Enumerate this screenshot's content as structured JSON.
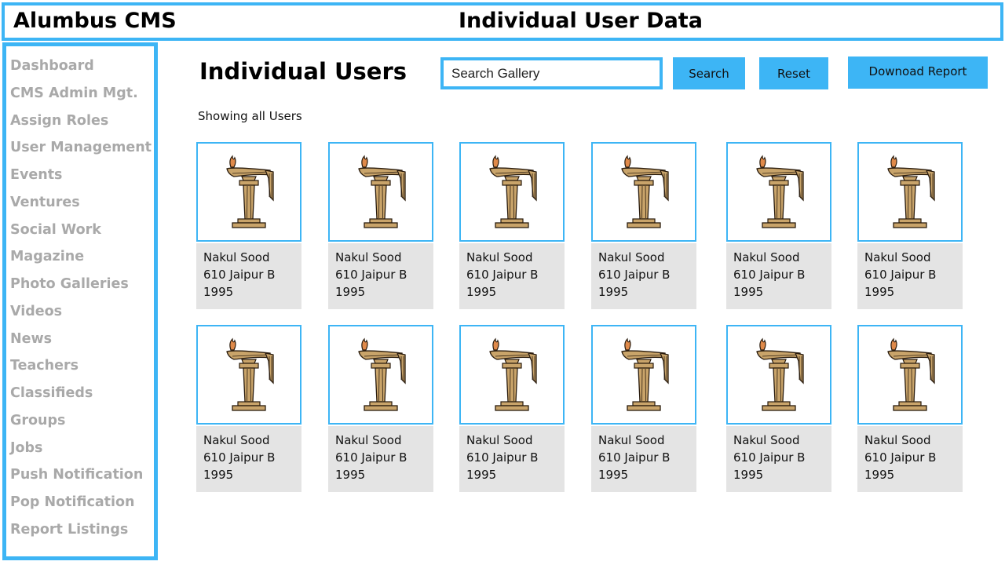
{
  "header": {
    "brand": "Alumbus CMS",
    "page_heading": "Individual User Data"
  },
  "sidebar": {
    "items": [
      {
        "label": "Dashboard",
        "name": "dashboard"
      },
      {
        "label": "CMS Admin Mgt.",
        "name": "cms-admin-mgt"
      },
      {
        "label": "Assign Roles",
        "name": "assign-roles"
      },
      {
        "label": "User Management",
        "name": "user-management"
      },
      {
        "label": "Events",
        "name": "events"
      },
      {
        "label": "Ventures",
        "name": "ventures"
      },
      {
        "label": "Social Work",
        "name": "social-work"
      },
      {
        "label": "Magazine",
        "name": "magazine"
      },
      {
        "label": "Photo Galleries",
        "name": "photo-galleries"
      },
      {
        "label": "Videos",
        "name": "videos"
      },
      {
        "label": "News",
        "name": "news"
      },
      {
        "label": "Teachers",
        "name": "teachers"
      },
      {
        "label": "Classifieds",
        "name": "classifieds"
      },
      {
        "label": "Groups",
        "name": "groups"
      },
      {
        "label": "Jobs",
        "name": "jobs"
      },
      {
        "label": "Push Notification",
        "name": "push-notification"
      },
      {
        "label": "Pop Notification",
        "name": "pop-notification"
      },
      {
        "label": "Report Listings",
        "name": "report-listings"
      }
    ]
  },
  "main": {
    "title": "Individual Users",
    "search_placeholder": "Search Gallery",
    "search_label": "Search",
    "reset_label": "Reset",
    "download_label": "Downoad Report",
    "showing_text": "Showing all Users"
  },
  "users": [
    {
      "name": "Nakul Sood",
      "address": "610 Jaipur B",
      "year": "1995",
      "icon": "lamp-logo-icon"
    },
    {
      "name": "Nakul Sood",
      "address": "610 Jaipur B",
      "year": "1995",
      "icon": "lamp-logo-icon"
    },
    {
      "name": "Nakul Sood",
      "address": "610 Jaipur B",
      "year": "1995",
      "icon": "lamp-logo-icon"
    },
    {
      "name": "Nakul Sood",
      "address": "610 Jaipur B",
      "year": "1995",
      "icon": "lamp-logo-icon"
    },
    {
      "name": "Nakul Sood",
      "address": "610 Jaipur B",
      "year": "1995",
      "icon": "lamp-logo-icon"
    },
    {
      "name": "Nakul Sood",
      "address": "610 Jaipur B",
      "year": "1995",
      "icon": "lamp-logo-icon"
    },
    {
      "name": "Nakul Sood",
      "address": "610 Jaipur B",
      "year": "1995",
      "icon": "lamp-logo-icon"
    },
    {
      "name": "Nakul Sood",
      "address": "610 Jaipur B",
      "year": "1995",
      "icon": "lamp-logo-icon"
    },
    {
      "name": "Nakul Sood",
      "address": "610 Jaipur B",
      "year": "1995",
      "icon": "lamp-logo-icon"
    },
    {
      "name": "Nakul Sood",
      "address": "610 Jaipur B",
      "year": "1995",
      "icon": "lamp-logo-icon"
    },
    {
      "name": "Nakul Sood",
      "address": "610 Jaipur B",
      "year": "1995",
      "icon": "lamp-logo-icon"
    },
    {
      "name": "Nakul Sood",
      "address": "610 Jaipur B",
      "year": "1995",
      "icon": "lamp-logo-icon"
    }
  ],
  "colors": {
    "accent": "#3db5f5",
    "nav_text": "#a9a9a9",
    "card_info_bg": "#e4e4e4",
    "lamp_fill": "#c9a46a"
  }
}
